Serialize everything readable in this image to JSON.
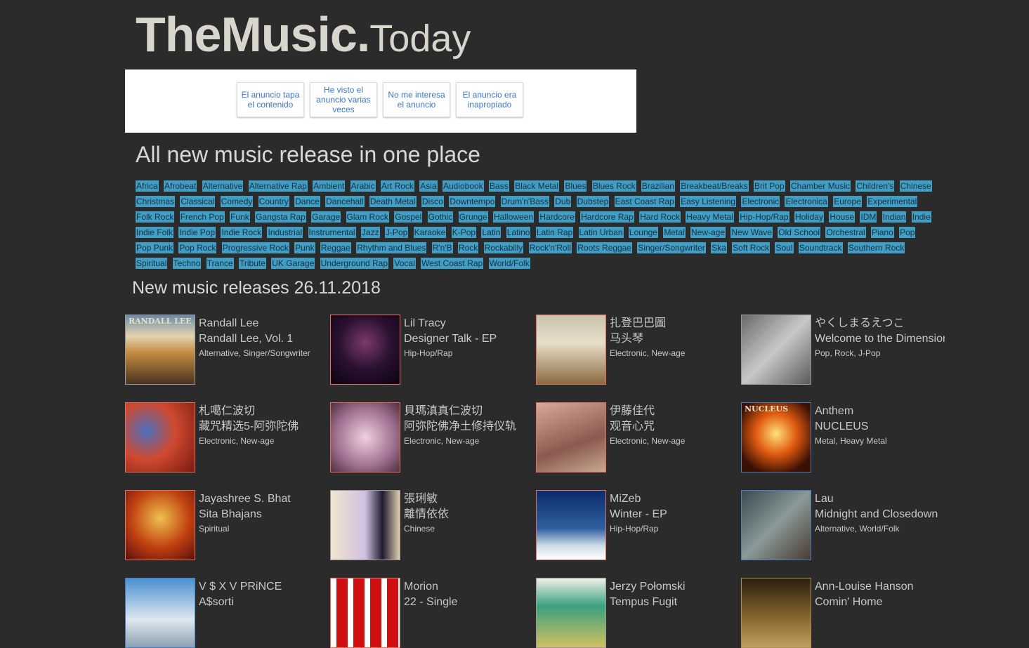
{
  "logo": {
    "main": "TheMusic.",
    "sub": "Today"
  },
  "ad_feedback": [
    "El anuncio tapa el contenido",
    "He visto el anuncio varias veces",
    "No me interesa el anuncio",
    "El anuncio era inapropiado"
  ],
  "headline": "All new music release in one place",
  "genres": [
    "Africa",
    "Afrobeat",
    "Alternative",
    "Alternative Rap",
    "Ambient",
    "Arabic",
    "Art Rock",
    "Asia",
    "Audiobook",
    "Bass",
    "Black Metal",
    "Blues",
    "Blues Rock",
    "Brazilian",
    "Breakbeat/Breaks",
    "Brit Pop",
    "Chamber Music",
    "Children's",
    "Chinese",
    "Christmas",
    "Classical",
    "Comedy",
    "Country",
    "Dance",
    "Dancehall",
    "Death Metal",
    "Disco",
    "Downtempo",
    "Drum'n'Bass",
    "Dub",
    "Dubstep",
    "East Coast Rap",
    "Easy Listening",
    "Electronic",
    "Electronica",
    "Europe",
    "Experimental",
    "Folk Rock",
    "French Pop",
    "Funk",
    "Gangsta Rap",
    "Garage",
    "Glam Rock",
    "Gospel",
    "Gothic",
    "Grunge",
    "Halloween",
    "Hardcore",
    "Hardcore Rap",
    "Hard Rock",
    "Heavy Metal",
    "Hip-Hop/Rap",
    "Holiday",
    "House",
    "IDM",
    "Indian",
    "Indie",
    "Indie Folk",
    "Indie Pop",
    "Indie Rock",
    "Industrial",
    "Instrumental",
    "Jazz",
    "J-Pop",
    "Karaoke",
    "K-Pop",
    "Latin",
    "Latino",
    "Latin Rap",
    "Latin Urban",
    "Lounge",
    "Metal",
    "New-age",
    "New Wave",
    "Old School",
    "Orchestral",
    "Piano",
    "Pop",
    "Pop Punk",
    "Pop Rock",
    "Progressive Rock",
    "Punk",
    "Reggae",
    "Rhythm and Blues",
    "R'n'B",
    "Rock",
    "Rockabilly",
    "Rock'n'Roll",
    "Roots Reggae",
    "Singer/Songwriter",
    "Ska",
    "Soft Rock",
    "Soul",
    "Soundtrack",
    "Southern Rock",
    "Spiritual",
    "Techno",
    "Trance",
    "Tribute",
    "UK Garage",
    "Underground Rap",
    "Vocal",
    "West Coast Rap",
    "World/Folk"
  ],
  "releases_title": "New music releases 26.11.2018",
  "releases": [
    {
      "artist": "Randall Lee",
      "album": "Randall Lee, Vol. 1",
      "genres": "Alternative, Singer/Songwriter",
      "cover_label": "RANDALL LEE"
    },
    {
      "artist": "Lil Tracy",
      "album": "Designer Talk - EP",
      "genres": "Hip-Hop/Rap",
      "cover_label": ""
    },
    {
      "artist": "扎登巴巴圖",
      "album": "马头琴",
      "genres": "Electronic, New-age",
      "cover_label": ""
    },
    {
      "artist": "やくしまるえつこ",
      "album": "Welcome to the Dimension",
      "genres": "Pop, Rock, J-Pop",
      "cover_label": ""
    },
    {
      "artist": "札噶仁波切",
      "album": "藏咒精选5-阿弥陀佛",
      "genres": "Electronic, New-age",
      "cover_label": ""
    },
    {
      "artist": "貝瑪滇真仁波切",
      "album": "阿弥陀佛净土修持仪轨",
      "genres": "Electronic, New-age",
      "cover_label": ""
    },
    {
      "artist": "伊藤佳代",
      "album": "观音心咒",
      "genres": "Electronic, New-age",
      "cover_label": ""
    },
    {
      "artist": "Anthem",
      "album": "NUCLEUS",
      "genres": "Metal, Heavy Metal",
      "cover_label": "NUCLEUS"
    },
    {
      "artist": "Jayashree S. Bhat",
      "album": "Sita Bhajans",
      "genres": "Spiritual",
      "cover_label": ""
    },
    {
      "artist": "張琍敏",
      "album": "離情依依",
      "genres": "Chinese",
      "cover_label": ""
    },
    {
      "artist": "MiZeb",
      "album": "Winter - EP",
      "genres": "Hip-Hop/Rap",
      "cover_label": ""
    },
    {
      "artist": "Lau",
      "album": "Midnight and Closedown",
      "genres": "Alternative, World/Folk",
      "cover_label": ""
    },
    {
      "artist": "V $ X V PRiNCE",
      "album": "A$sorti",
      "genres": "",
      "cover_label": ""
    },
    {
      "artist": "Morion",
      "album": "22 - Single",
      "genres": "",
      "cover_label": ""
    },
    {
      "artist": "Jerzy Połomski",
      "album": "Tempus Fugit",
      "genres": "",
      "cover_label": ""
    },
    {
      "artist": "Ann-Louise Hanson",
      "album": "Comin' Home",
      "genres": "",
      "cover_label": ""
    }
  ]
}
